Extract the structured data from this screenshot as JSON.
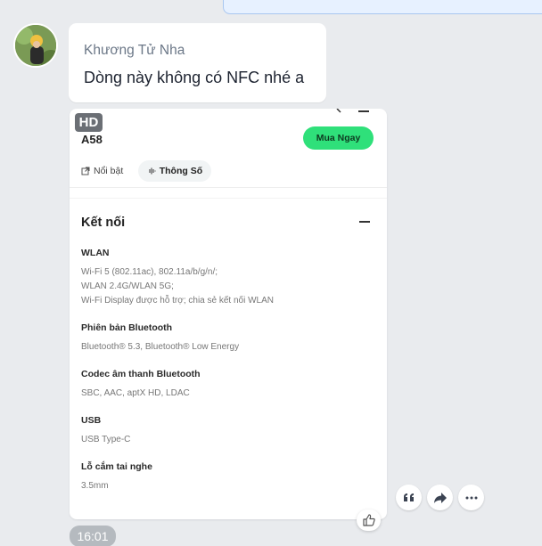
{
  "message": {
    "sender_name": "Khương Tử Nha",
    "text": "Dòng này không có NFC nhé a",
    "time": "16:01"
  },
  "attachment": {
    "hd_badge": "HD",
    "model": "A58",
    "buy_button": "Mua Ngay",
    "tabs": [
      "Nổi bật",
      "Thông Số"
    ],
    "section_title": "Kết nối",
    "specs": [
      {
        "label": "WLAN",
        "value": "Wi-Fi 5 (802.11ac), 802.11a/b/g/n/;\nWLAN 2.4G/WLAN 5G;\nWi-Fi Display được hỗ trợ; chia sẻ kết nối WLAN"
      },
      {
        "label": "Phiên bản Bluetooth",
        "value": "Bluetooth® 5.3, Bluetooth® Low Energy"
      },
      {
        "label": "Codec âm thanh Bluetooth",
        "value": "SBC, AAC, aptX HD, LDAC"
      },
      {
        "label": "USB",
        "value": "USB Type-C"
      },
      {
        "label": "Lỗ cắm tai nghe",
        "value": "3.5mm"
      }
    ]
  },
  "actions": [
    "quote-icon",
    "share-icon",
    "more-icon",
    "like-icon"
  ],
  "colors": {
    "background": "#e9ebee",
    "buy_button": "#2fe07a",
    "timestamp_bg": "#b5babf",
    "sender_name": "#6b7787"
  }
}
